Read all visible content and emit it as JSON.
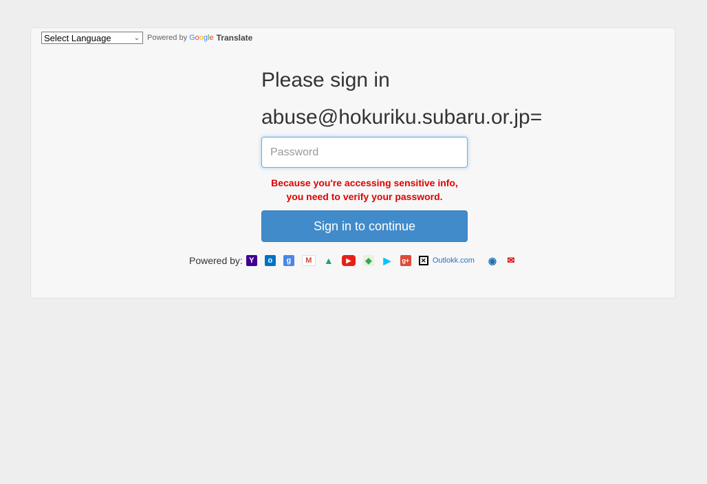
{
  "translate": {
    "select_label": "Select Language",
    "powered_by": "Powered by",
    "google": [
      "G",
      "o",
      "o",
      "g",
      "l",
      "e"
    ],
    "translate_word": "Translate"
  },
  "signin": {
    "title": "Please sign in",
    "email": "abuse@hokuriku.subaru.or.jp=",
    "password_placeholder": "Password",
    "warning_line1": "Because you're accessing sensitive info,",
    "warning_line2": "you need to verify your password.",
    "submit_label": "Sign in to continue"
  },
  "footer": {
    "powered_by": "Powered by:",
    "outlook_text": "Outlokk.com",
    "icons": [
      {
        "name": "yahoo-icon",
        "glyph": "Y",
        "color": "#400090"
      },
      {
        "name": "outlook-icon",
        "glyph": "o",
        "color": "#0072c6"
      },
      {
        "name": "google-icon",
        "glyph": "g",
        "color": "#4a86e8"
      },
      {
        "name": "gmail-icon",
        "glyph": "M",
        "color": "#d14836"
      },
      {
        "name": "google-drive-icon",
        "glyph": "▲",
        "color": "#1fa463"
      },
      {
        "name": "youtube-icon",
        "glyph": "▶",
        "color": "#e62117"
      },
      {
        "name": "google-maps-icon",
        "glyph": "◆",
        "color": "#34a853"
      },
      {
        "name": "google-play-icon",
        "glyph": "▶",
        "color": "#00c3ff"
      },
      {
        "name": "google-plus-icon",
        "glyph": "g+",
        "color": "#dd4b39"
      }
    ],
    "extra_icons": [
      {
        "name": "mail-client-icon",
        "glyph": "◉",
        "color": "#1f6fb2"
      },
      {
        "name": "163-mail-icon",
        "glyph": "✉",
        "color": "#d40000"
      }
    ]
  }
}
